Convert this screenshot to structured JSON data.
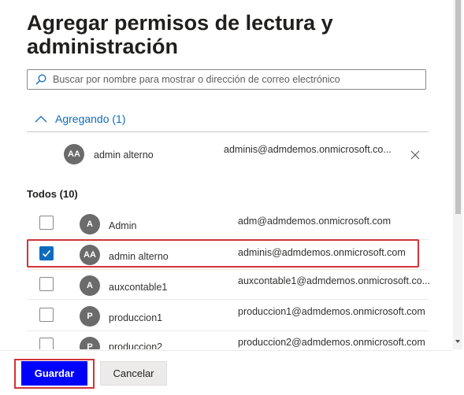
{
  "panel": {
    "title": "Agregar permisos de lectura y administración"
  },
  "search": {
    "placeholder": "Buscar por nombre para mostrar o dirección de correo electrónico",
    "value": ""
  },
  "adding": {
    "toggle_label": "Agregando (1)",
    "items": [
      {
        "initials": "AA",
        "name": "admin alterno",
        "email": "adminis@admdemos.onmicrosoft.co..."
      }
    ]
  },
  "all": {
    "section_label": "Todos (10)",
    "items": [
      {
        "initials": "A",
        "name": "Admin",
        "email": "adm@admdemos.onmicrosoft.com",
        "checked": false
      },
      {
        "initials": "AA",
        "name": "admin alterno",
        "email": "adminis@admdemos.onmicrosoft.com",
        "checked": true
      },
      {
        "initials": "A",
        "name": "auxcontable1",
        "email": "auxcontable1@admdemos.onmicrosoft.co...",
        "checked": false
      },
      {
        "initials": "P",
        "name": "produccion1",
        "email": "produccion1@admdemos.onmicrosoft.com",
        "checked": false
      },
      {
        "initials": "P",
        "name": "produccion2",
        "email": "produccion2@admdemos.onmicrosoft.com",
        "checked": false
      }
    ]
  },
  "buttons": {
    "save_label": "Guardar",
    "cancel_label": "Cancelar"
  },
  "colors": {
    "accent": "#0f6cbd",
    "primary_button": "#0000ff",
    "highlight": "#d13438",
    "avatar": "#6b6b6b"
  }
}
